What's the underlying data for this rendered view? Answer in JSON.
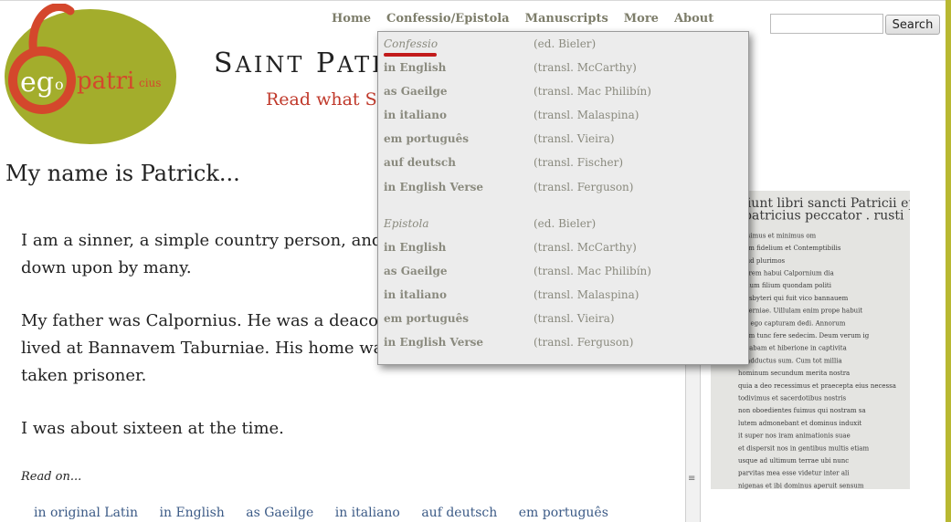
{
  "nav": {
    "items": [
      "Home",
      "Confessio/Epistola",
      "Manuscripts",
      "More",
      "About"
    ]
  },
  "search": {
    "placeholder": "",
    "button_label": "Search"
  },
  "logo": {
    "ego": "eg",
    "o": "o",
    "patri": "patri",
    "cius": "cius"
  },
  "site": {
    "title_first_cap": "S",
    "title_first_rest": "AINT",
    "title_second_cap": "P",
    "title_second_rest": "ATRI",
    "tagline": "Read what St P"
  },
  "main": {
    "title": "My name is Patrick...",
    "paragraphs": [
      [
        "I am a sinner, a simple country person, and th",
        "down upon by many."
      ],
      [
        "My father was Calpornius. He was a deacon; h",
        "lived at Bannavem Taburniae. His home was",
        "taken prisoner."
      ],
      [
        "I was about sixteen at the time."
      ]
    ],
    "read_on": "Read on...",
    "language_links": [
      "in original Latin",
      "in English",
      "as Gaeilge",
      "in italiano",
      "auf deutsch",
      "em português"
    ]
  },
  "splitter_grip": "≡",
  "dropdown": {
    "sections": [
      {
        "items": [
          {
            "label": "Confessio",
            "translator": "(ed. Bieler)",
            "heading": true
          },
          {
            "label": "in English",
            "translator": "(transl. McCarthy)"
          },
          {
            "label": "as Gaeilge",
            "translator": "(transl. Mac Philibín)"
          },
          {
            "label": "in italiano",
            "translator": "(transl. Malaspina)"
          },
          {
            "label": "em português",
            "translator": "(transl. Vieira)"
          },
          {
            "label": "auf deutsch",
            "translator": "(transl. Fischer)"
          },
          {
            "label": "in English Verse",
            "translator": "(transl. Ferguson)"
          }
        ]
      },
      {
        "items": [
          {
            "label": "Epistola",
            "translator": "(ed. Bieler)",
            "heading": true
          },
          {
            "label": "in English",
            "translator": "(transl. McCarthy)"
          },
          {
            "label": "as Gaeilge",
            "translator": "(transl. Mac Philibín)"
          },
          {
            "label": "in italiano",
            "translator": "(transl. Malaspina)"
          },
          {
            "label": "em português",
            "translator": "(transl. Vieira)"
          },
          {
            "label": "in English Verse",
            "translator": "(transl. Ferguson)"
          }
        ]
      }
    ]
  },
  "manuscript_lines": [
    "Incipiunt libri sancti Patricii episcopi",
    "Ego patricius peccator . rusti",
    "cissimus et minimus om",
    "nium fidelium et Contemptibilis",
    "apud plurimos",
    "patrem habui Calpornium dia",
    "conum filium quondam politi",
    "presbyteri qui fuit vico bannauem",
    "taberniae. Uillulam enim prope habuit",
    "ubi ego capturam dedi. Annorum",
    "eram tunc fere sedecim. Deum verum ig",
    "norabam et hiberione in captivita",
    "te adductus sum. Cum tot millia",
    "hominum secundum merita nostra",
    "quia a deo recessimus et praecepta eius necessa",
    "todivimus et sacerdotibus nostris",
    "non oboedientes fuimus qui nostram sa",
    "lutem admonebant et dominus induxit",
    "it super nos iram animationis suae",
    "et dispersit nos in gentibus multis etiam",
    "usque ad ultimum terrae ubi nunc",
    "parvitas mea esse videtur inter ali",
    "nigenas et ibi dominus aperuit sensum"
  ]
}
